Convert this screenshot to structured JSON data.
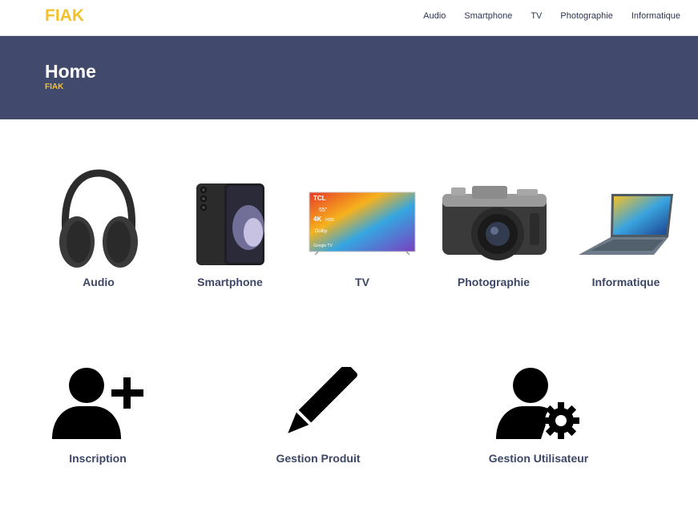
{
  "brand": "FIAK",
  "nav": {
    "items": [
      {
        "label": "Audio"
      },
      {
        "label": "Smartphone"
      },
      {
        "label": "TV"
      },
      {
        "label": "Photographie"
      },
      {
        "label": "Informatique"
      }
    ]
  },
  "header": {
    "title": "Home",
    "subtitle": "FIAK"
  },
  "categories": [
    {
      "label": "Audio",
      "icon": "headphones-icon"
    },
    {
      "label": "Smartphone",
      "icon": "smartphone-icon"
    },
    {
      "label": "TV",
      "icon": "tv-icon"
    },
    {
      "label": "Photographie",
      "icon": "camera-icon"
    },
    {
      "label": "Informatique",
      "icon": "laptop-icon"
    }
  ],
  "tv_screen": {
    "brand": "TCL",
    "size": "55\"",
    "badge_4k": "4K",
    "hdr": "HDR",
    "dolby": "Dolby",
    "os": "Google TV"
  },
  "actions": [
    {
      "label": "Inscription",
      "icon": "user-plus-icon"
    },
    {
      "label": "Gestion Produit",
      "icon": "pencil-icon"
    },
    {
      "label": "Gestion Utilisateur",
      "icon": "user-gear-icon"
    }
  ],
  "colors": {
    "accent": "#f2c22e",
    "header_bg": "#414a6d",
    "text": "#3d4766"
  }
}
